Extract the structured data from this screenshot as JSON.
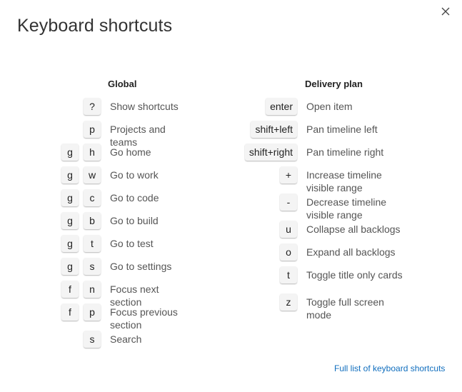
{
  "dialog": {
    "title": "Keyboard shortcuts",
    "close_label": "×",
    "footer_link": "Full list of keyboard shortcuts"
  },
  "global": {
    "heading": "Global",
    "shortcuts": [
      {
        "keys": [
          "?"
        ],
        "label": "Show shortcuts"
      },
      {
        "keys": [
          "p"
        ],
        "label": "Projects and teams"
      },
      {
        "keys": [
          "g",
          "h"
        ],
        "label": "Go home"
      },
      {
        "keys": [
          "g",
          "w"
        ],
        "label": "Go to work"
      },
      {
        "keys": [
          "g",
          "c"
        ],
        "label": "Go to code"
      },
      {
        "keys": [
          "g",
          "b"
        ],
        "label": "Go to build"
      },
      {
        "keys": [
          "g",
          "t"
        ],
        "label": "Go to test"
      },
      {
        "keys": [
          "g",
          "s"
        ],
        "label": "Go to settings"
      },
      {
        "keys": [
          "f",
          "n"
        ],
        "label": "Focus next section"
      },
      {
        "keys": [
          "f",
          "p"
        ],
        "label": "Focus previous section"
      },
      {
        "keys": [
          "s"
        ],
        "label": "Search"
      }
    ]
  },
  "delivery_plan": {
    "heading": "Delivery plan",
    "shortcuts": [
      {
        "keys": [
          "enter"
        ],
        "label": "Open item"
      },
      {
        "keys": [
          "shift+left"
        ],
        "label": "Pan timeline left"
      },
      {
        "keys": [
          "shift+right"
        ],
        "label": "Pan timeline right"
      },
      {
        "keys": [
          "+"
        ],
        "label": "Increase timeline visible range"
      },
      {
        "keys": [
          "-"
        ],
        "label": "Decrease timeline visible range"
      },
      {
        "keys": [
          "u"
        ],
        "label": "Collapse all backlogs"
      },
      {
        "keys": [
          "o"
        ],
        "label": "Expand all backlogs"
      },
      {
        "keys": [
          "t"
        ],
        "label": "Toggle title only cards"
      },
      {
        "keys": [
          "z"
        ],
        "label": "Toggle full screen mode"
      }
    ]
  },
  "colors": {
    "link": "#106ebe",
    "key_background": "#f4f4f4",
    "description_text": "#555555"
  },
  "icons": {
    "close": "close-icon"
  }
}
